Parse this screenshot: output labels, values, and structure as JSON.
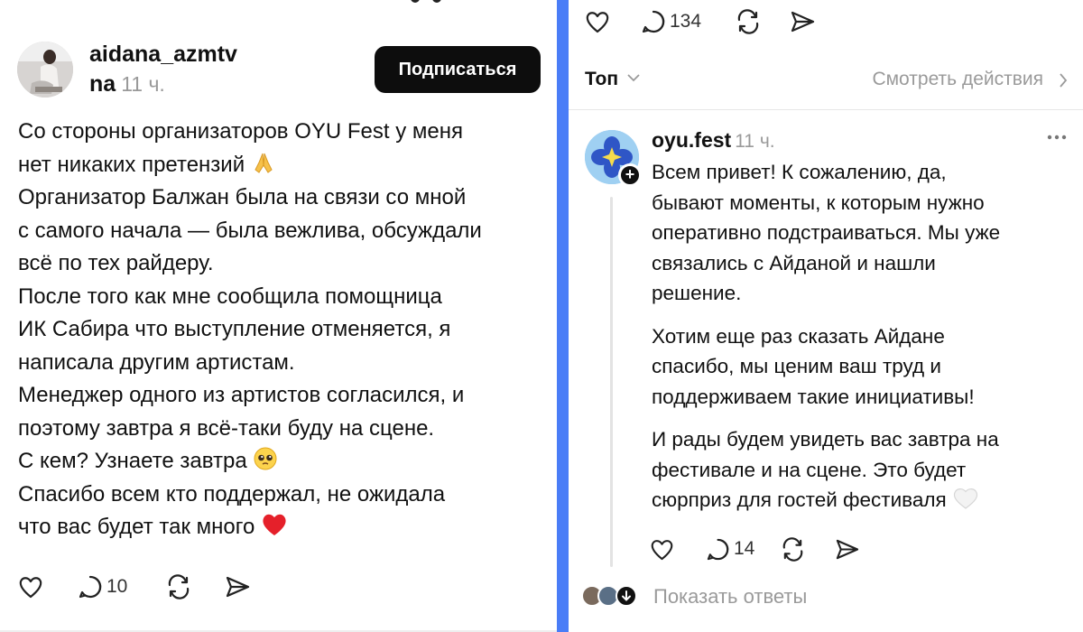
{
  "left_post": {
    "username_line1": "aidana_azmtv",
    "username_line2": "na",
    "time": "11 ч.",
    "follow_label": "Подписаться",
    "lines": [
      "Со стороны организаторов OYU Fest у меня",
      "нет никаких претензий",
      "Организатор Балжан была на связи со мной",
      "с самого начала — была вежлива, обсуждали",
      "всё по тех райдеру.",
      "После того как мне сообщила помощница",
      "ИК Сабира  что выступление отменяется, я",
      "написала другим артистам.",
      "Менеджер одного из артистов согласился, и",
      "поэтому завтра я всё-таки буду на сцене.",
      "С кем? Узнаете завтра",
      "Спасибо всем кто поддержал, не ожидала",
      "что вас будет так много"
    ],
    "emojis": {
      "line2": "folded-hands-emoji",
      "line11": "pleading-face-emoji",
      "line13": "red-heart-emoji"
    },
    "reply_count": "10"
  },
  "right_pane": {
    "top_reply_count": "134",
    "sort_label": "Топ",
    "activity_label": "Смотреть действия",
    "reply": {
      "username": "oyu.fest",
      "time": "11 ч.",
      "paragraph1": [
        "Всем привет! К сожалению, да,",
        "бывают моменты, к которым нужно",
        "оперативно подстраиваться. Мы уже",
        "связались с Айданой и нашли",
        "решение."
      ],
      "paragraph2": [
        "Хотим еще раз сказать Айдане",
        "спасибо, мы ценим ваш труд и",
        "поддерживаем такие инициативы!"
      ],
      "paragraph3": [
        "И рады будем увидеть вас завтра на",
        "фестивале и на сцене. Это будет",
        "сюрприз для гостей фестиваля"
      ],
      "end_emoji": "white-heart-emoji",
      "reply_count": "14"
    },
    "show_replies_label": "Показать ответы"
  },
  "colors": {
    "divider": "#4a7df7",
    "follow_button_bg": "#0d0d0d",
    "muted_text": "#9a9a9a"
  }
}
